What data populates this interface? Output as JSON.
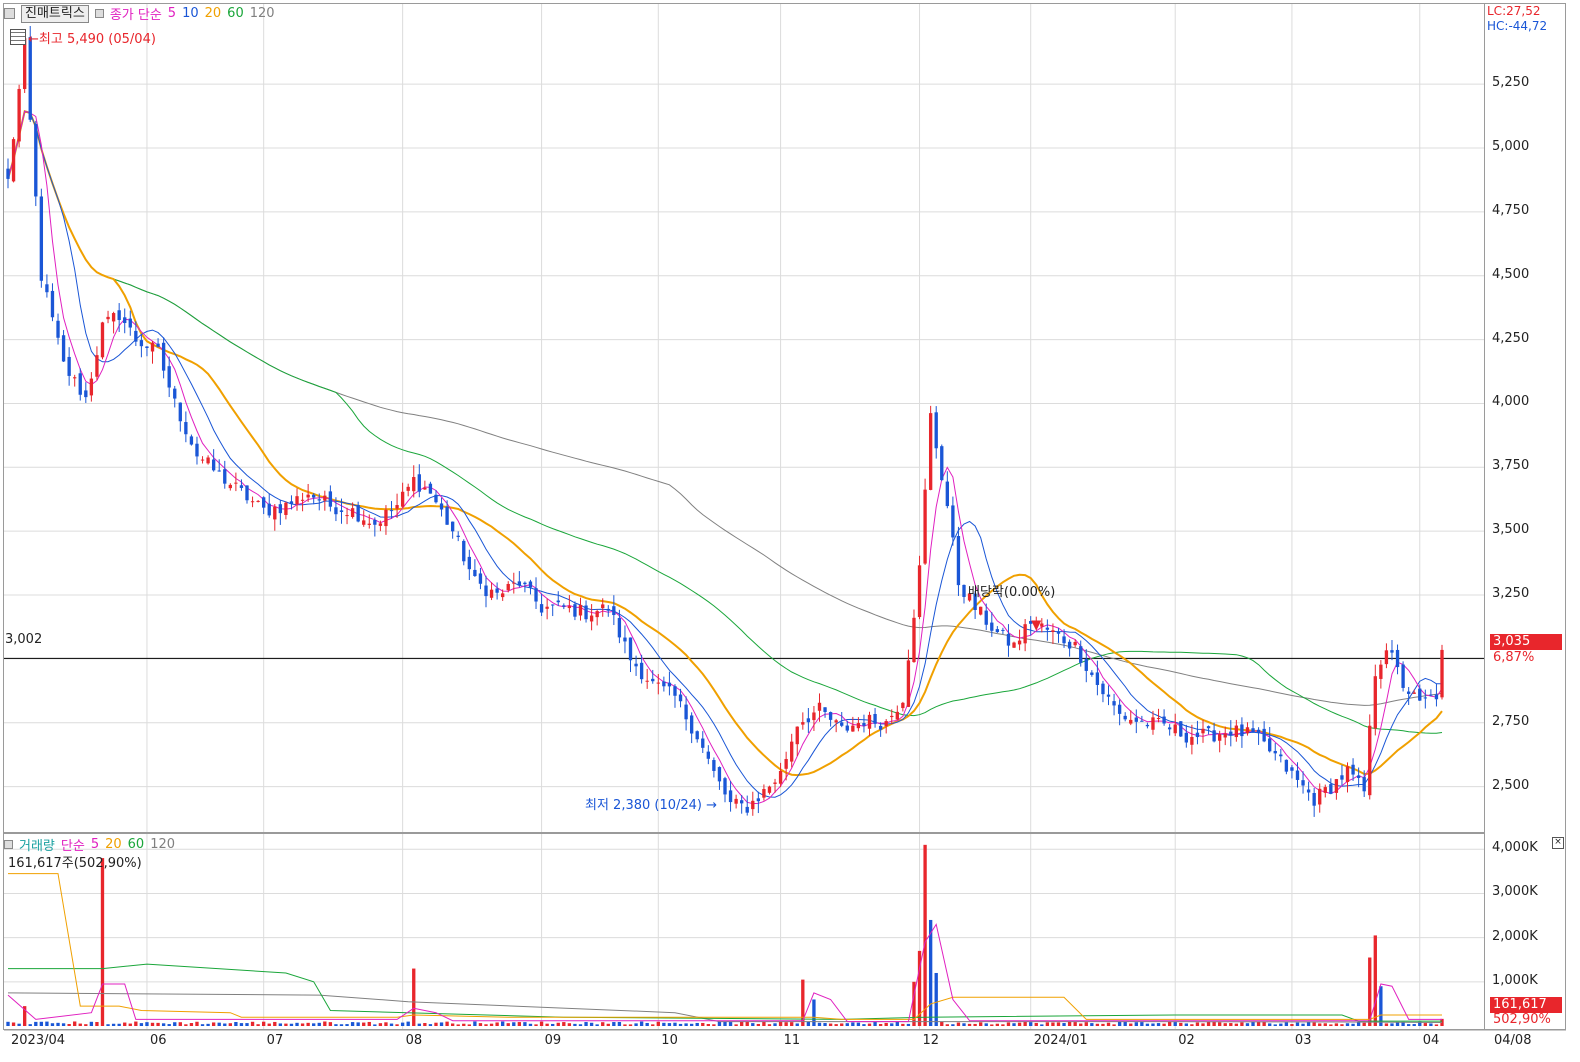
{
  "legend_top": {
    "tool_label": "진매트릭스",
    "series_label": "종가 단순",
    "ma": [
      {
        "label": "5",
        "color": "#e020c0"
      },
      {
        "label": "10",
        "color": "#1a56d6"
      },
      {
        "label": "20",
        "color": "#f0a000"
      },
      {
        "label": "60",
        "color": "#1aa63a"
      },
      {
        "label": "120",
        "color": "#808080"
      }
    ]
  },
  "legend_bottom": {
    "series_label": "거래량",
    "type_label": "단순",
    "ma": [
      {
        "label": "5",
        "color": "#e020c0"
      },
      {
        "label": "20",
        "color": "#f0a000"
      },
      {
        "label": "60",
        "color": "#1aa63a"
      },
      {
        "label": "120",
        "color": "#808080"
      }
    ],
    "volume_readout": "161,617주(502,90%)"
  },
  "annotations": {
    "high": "최고 5,490 (05/04)",
    "low": "최저 2,380 (10/24)",
    "dividend": "배당락(0.00%)",
    "ref_line": "3,002",
    "lc": "LC:27,52",
    "hc": "HC:-44,72"
  },
  "price_tags": {
    "last_price": "3,035",
    "last_change": "6,87%",
    "last_volume": "161,617",
    "volume_pct": "502,90%"
  },
  "colors": {
    "up": "#e8262c",
    "down": "#1a56d6",
    "ma5": "#e020c0",
    "ma10": "#1a56d6",
    "ma20": "#f0a000",
    "ma60": "#1aa63a",
    "ma120": "#808080",
    "grid": "#dcdcdc"
  },
  "chart_data": [
    {
      "type": "candlestick",
      "ylim": [
        2330,
        5560
      ],
      "yticks": [
        2500,
        2750,
        3000,
        3250,
        3500,
        3750,
        4000,
        4250,
        4500,
        4750,
        5000,
        5250
      ],
      "ytick_labels": [
        "2,500",
        "2,750",
        "",
        "3,250",
        "3,500",
        "3,750",
        "4,000",
        "4,250",
        "4,500",
        "4,750",
        "5,000",
        "5,250"
      ],
      "xticks": [
        {
          "label": "2023/04",
          "day": 0
        },
        {
          "label": "06",
          "day": 25
        },
        {
          "label": "07",
          "day": 46
        },
        {
          "label": "08",
          "day": 71
        },
        {
          "label": "09",
          "day": 96
        },
        {
          "label": "10",
          "day": 117
        },
        {
          "label": "11",
          "day": 139
        },
        {
          "label": "12",
          "day": 164
        },
        {
          "label": "2024/01",
          "day": 184
        },
        {
          "label": "02",
          "day": 210
        },
        {
          "label": "03",
          "day": 231
        },
        {
          "label": "04",
          "day": 254
        },
        {
          "label": "04/08",
          "day": 0
        }
      ],
      "ref_line": 3002,
      "keypoints": [
        [
          0,
          4870
        ],
        [
          3,
          5400
        ],
        [
          6,
          4500
        ],
        [
          10,
          4150
        ],
        [
          14,
          4020
        ],
        [
          17,
          4300
        ],
        [
          20,
          4350
        ],
        [
          23,
          4250
        ],
        [
          27,
          4200
        ],
        [
          30,
          4000
        ],
        [
          34,
          3800
        ],
        [
          38,
          3720
        ],
        [
          42,
          3650
        ],
        [
          46,
          3580
        ],
        [
          50,
          3600
        ],
        [
          54,
          3650
        ],
        [
          58,
          3600
        ],
        [
          62,
          3580
        ],
        [
          66,
          3530
        ],
        [
          70,
          3600
        ],
        [
          73,
          3700
        ],
        [
          76,
          3650
        ],
        [
          80,
          3500
        ],
        [
          84,
          3300
        ],
        [
          88,
          3250
        ],
        [
          92,
          3300
        ],
        [
          96,
          3200
        ],
        [
          100,
          3200
        ],
        [
          104,
          3180
        ],
        [
          108,
          3200
        ],
        [
          112,
          3000
        ],
        [
          116,
          2900
        ],
        [
          120,
          2850
        ],
        [
          124,
          2700
        ],
        [
          127,
          2550
        ],
        [
          130,
          2430
        ],
        [
          133,
          2420
        ],
        [
          136,
          2480
        ],
        [
          139,
          2550
        ],
        [
          142,
          2750
        ],
        [
          146,
          2800
        ],
        [
          150,
          2720
        ],
        [
          154,
          2760
        ],
        [
          158,
          2750
        ],
        [
          161,
          2850
        ],
        [
          164,
          3350
        ],
        [
          166,
          3950
        ],
        [
          169,
          3600
        ],
        [
          171,
          3300
        ],
        [
          174,
          3200
        ],
        [
          178,
          3100
        ],
        [
          181,
          3050
        ],
        [
          184,
          3150
        ],
        [
          188,
          3100
        ],
        [
          192,
          3050
        ],
        [
          196,
          2900
        ],
        [
          200,
          2780
        ],
        [
          204,
          2750
        ],
        [
          208,
          2740
        ],
        [
          212,
          2700
        ],
        [
          216,
          2700
        ],
        [
          220,
          2720
        ],
        [
          224,
          2700
        ],
        [
          228,
          2620
        ],
        [
          232,
          2520
        ],
        [
          235,
          2450
        ],
        [
          238,
          2500
        ],
        [
          241,
          2560
        ],
        [
          244,
          2480
        ],
        [
          246,
          2950
        ],
        [
          248,
          3050
        ],
        [
          251,
          2900
        ],
        [
          254,
          2820
        ],
        [
          257,
          2860
        ],
        [
          258,
          3035
        ]
      ],
      "candle_volatility": 60,
      "last_close": 3035
    },
    {
      "type": "bar",
      "series_name": "거래량",
      "ylim": [
        0,
        4300000
      ],
      "yticks": [
        1000000,
        2000000,
        3000000,
        4000000
      ],
      "ytick_labels": [
        "1,000K",
        "2,000K",
        "3,000K",
        "4,000K"
      ],
      "base_volume": 70000,
      "spikes": [
        {
          "day": 3,
          "value": 450000,
          "up": true
        },
        {
          "day": 17,
          "value": 3800000,
          "up": true
        },
        {
          "day": 73,
          "value": 1300000,
          "up": true
        },
        {
          "day": 143,
          "value": 1050000,
          "up": true
        },
        {
          "day": 145,
          "value": 600000,
          "up": false
        },
        {
          "day": 163,
          "value": 1000000,
          "up": true
        },
        {
          "day": 164,
          "value": 1700000,
          "up": true
        },
        {
          "day": 165,
          "value": 4100000,
          "up": true
        },
        {
          "day": 166,
          "value": 2400000,
          "up": false
        },
        {
          "day": 167,
          "value": 1200000,
          "up": false
        },
        {
          "day": 245,
          "value": 1550000,
          "up": true
        },
        {
          "day": 246,
          "value": 2050000,
          "up": true
        },
        {
          "day": 247,
          "value": 900000,
          "up": false
        },
        {
          "day": 258,
          "value": 161617,
          "up": true
        }
      ],
      "ma": {
        "ma5": [
          [
            0,
            700000
          ],
          [
            5,
            150000
          ],
          [
            15,
            300000
          ],
          [
            17,
            950000
          ],
          [
            21,
            950000
          ],
          [
            23,
            150000
          ],
          [
            70,
            150000
          ],
          [
            73,
            400000
          ],
          [
            77,
            300000
          ],
          [
            80,
            120000
          ],
          [
            143,
            120000
          ],
          [
            145,
            750000
          ],
          [
            148,
            600000
          ],
          [
            151,
            100000
          ],
          [
            162,
            100000
          ],
          [
            165,
            1900000
          ],
          [
            167,
            2300000
          ],
          [
            170,
            600000
          ],
          [
            173,
            120000
          ],
          [
            245,
            120000
          ],
          [
            247,
            950000
          ],
          [
            249,
            900000
          ],
          [
            252,
            150000
          ],
          [
            258,
            150000
          ]
        ],
        "ma20": [
          [
            0,
            3450000
          ],
          [
            9,
            3450000
          ],
          [
            13,
            450000
          ],
          [
            20,
            450000
          ],
          [
            24,
            350000
          ],
          [
            40,
            300000
          ],
          [
            42,
            200000
          ],
          [
            70,
            200000
          ],
          [
            73,
            250000
          ],
          [
            90,
            200000
          ],
          [
            145,
            200000
          ],
          [
            150,
            150000
          ],
          [
            163,
            150000
          ],
          [
            166,
            500000
          ],
          [
            170,
            650000
          ],
          [
            190,
            650000
          ],
          [
            194,
            150000
          ],
          [
            245,
            150000
          ],
          [
            247,
            250000
          ],
          [
            258,
            250000
          ]
        ],
        "ma60": [
          [
            0,
            1300000
          ],
          [
            17,
            1300000
          ],
          [
            25,
            1400000
          ],
          [
            50,
            1200000
          ],
          [
            55,
            1000000
          ],
          [
            58,
            350000
          ],
          [
            100,
            200000
          ],
          [
            150,
            150000
          ],
          [
            165,
            200000
          ],
          [
            210,
            250000
          ],
          [
            240,
            250000
          ],
          [
            243,
            110000
          ],
          [
            258,
            110000
          ]
        ],
        "ma120": [
          [
            0,
            750000
          ],
          [
            56,
            700000
          ],
          [
            72,
            550000
          ],
          [
            120,
            300000
          ],
          [
            128,
            100000
          ],
          [
            150,
            100000
          ],
          [
            200,
            100000
          ],
          [
            240,
            90000
          ],
          [
            258,
            80000
          ]
        ]
      }
    }
  ]
}
